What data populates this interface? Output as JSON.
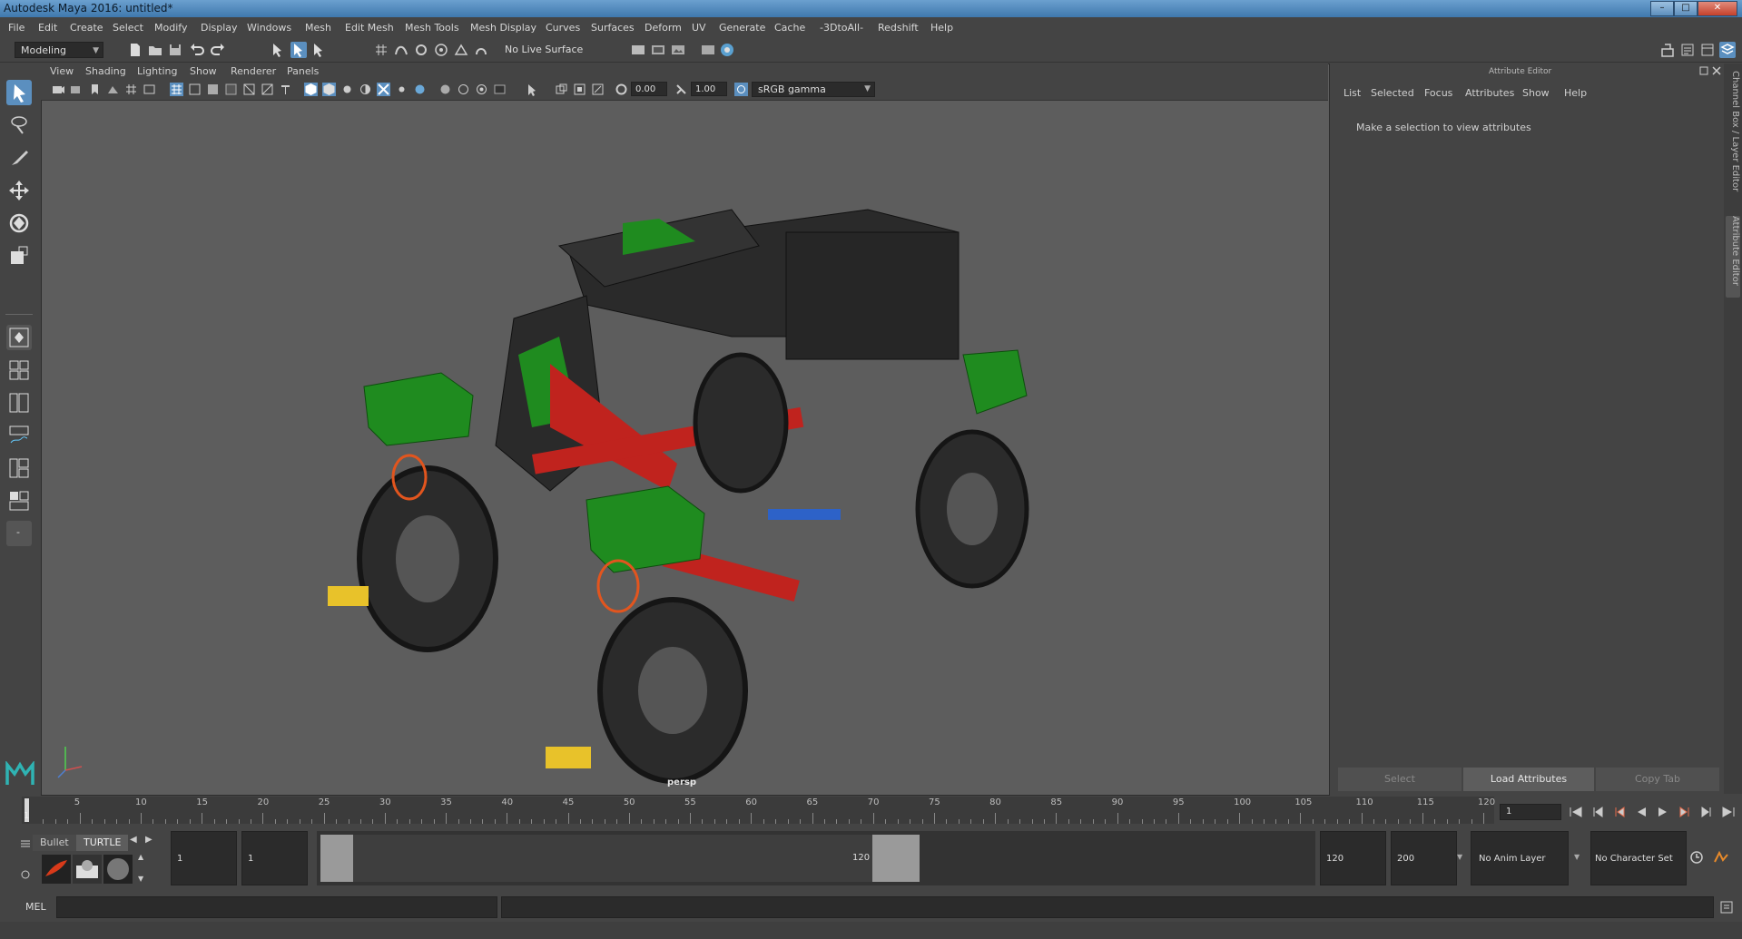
{
  "window": {
    "title": "Autodesk Maya 2016: untitled*"
  },
  "menu": [
    "File",
    "Edit",
    "Create",
    "Select",
    "Modify",
    "Display",
    "Windows",
    "Mesh",
    "Edit Mesh",
    "Mesh Tools",
    "Mesh Display",
    "Curves",
    "Surfaces",
    "Deform",
    "UV",
    "Generate",
    "Cache",
    "-3DtoAll-",
    "Redshift",
    "Help"
  ],
  "statusline": {
    "menuset": "Modeling",
    "live_surface": "No Live Surface"
  },
  "viewport": {
    "menu": [
      "View",
      "Shading",
      "Lighting",
      "Show",
      "Renderer",
      "Panels"
    ],
    "near_value": "0.00",
    "far_value": "1.00",
    "color_space": "sRGB gamma",
    "camera_label": "persp"
  },
  "attribute_editor": {
    "title": "Attribute Editor",
    "menu": [
      "List",
      "Selected",
      "Focus",
      "Attributes",
      "Show",
      "Help"
    ],
    "message": "Make a selection to view attributes",
    "buttons": {
      "select": "Select",
      "load": "Load Attributes",
      "copy": "Copy Tab"
    }
  },
  "side_tabs": {
    "channel_box": "Channel Box / Layer Editor",
    "attribute_editor": "Attribute Editor"
  },
  "timeline": {
    "ticks": [
      "5",
      "10",
      "15",
      "20",
      "25",
      "30",
      "35",
      "40",
      "45",
      "50",
      "55",
      "60",
      "65",
      "70",
      "75",
      "80",
      "85",
      "90",
      "95",
      "100",
      "105",
      "110",
      "115",
      "120"
    ],
    "start_label": "1",
    "current_frame": "1"
  },
  "shelf": {
    "tab_bullet": "Bullet",
    "tab_turtle": "TURTLE"
  },
  "range": {
    "start_time": "1",
    "playback_start": "1",
    "slider_start": "1",
    "slider_end": "120",
    "playback_end": "120",
    "end_time": "200",
    "anim_layer": "No Anim Layer",
    "character_set": "No Character Set"
  },
  "command_line": {
    "label": "MEL"
  },
  "colors": {
    "accent": "#5b8fbf",
    "viewport_bg": "#5d5d5d",
    "model_green": "#1e8a1e",
    "model_red": "#c0231e"
  }
}
